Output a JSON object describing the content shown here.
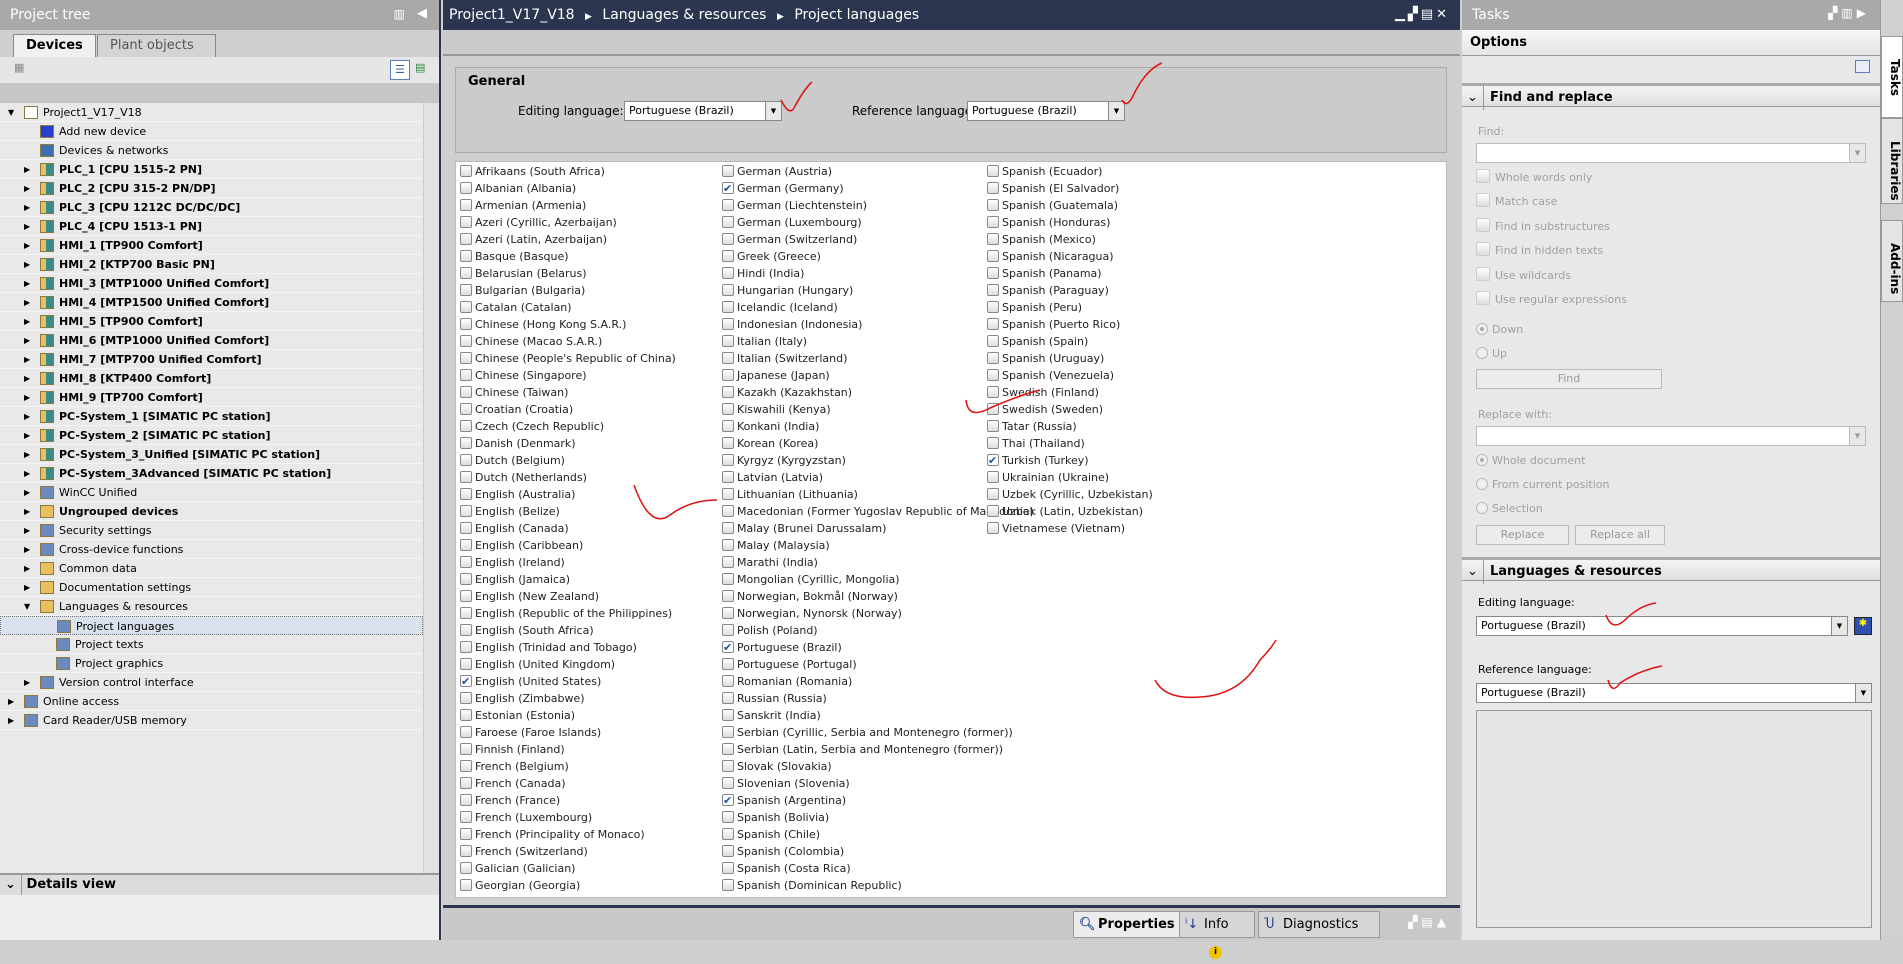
{
  "project_tree": {
    "title": "Project tree",
    "tabs": [
      "Devices",
      "Plant objects"
    ],
    "items": [
      {
        "label": "Project1_V17_V18",
        "level": 0,
        "expand": "open",
        "icon": "project-icon",
        "bold": false
      },
      {
        "label": "Add new device",
        "level": 1,
        "expand": "",
        "icon": "add-device-icon",
        "bold": false
      },
      {
        "label": "Devices & networks",
        "level": 1,
        "expand": "",
        "icon": "network-icon",
        "bold": false
      },
      {
        "label": "PLC_1 [CPU 1515-2 PN]",
        "level": 1,
        "expand": "closed",
        "icon": "plc-folder-icon",
        "bold": true
      },
      {
        "label": "PLC_2 [CPU 315-2 PN/DP]",
        "level": 1,
        "expand": "closed",
        "icon": "plc-folder-icon",
        "bold": true
      },
      {
        "label": "PLC_3 [CPU 1212C DC/DC/DC]",
        "level": 1,
        "expand": "closed",
        "icon": "plc-folder-icon",
        "bold": true
      },
      {
        "label": "PLC_4 [CPU 1513-1 PN]",
        "level": 1,
        "expand": "closed",
        "icon": "plc-folder-icon",
        "bold": true
      },
      {
        "label": "HMI_1 [TP900 Comfort]",
        "level": 1,
        "expand": "closed",
        "icon": "hmi-folder-icon",
        "bold": true
      },
      {
        "label": "HMI_2 [KTP700 Basic PN]",
        "level": 1,
        "expand": "closed",
        "icon": "hmi-folder-icon",
        "bold": true
      },
      {
        "label": "HMI_3 [MTP1000 Unified Comfort]",
        "level": 1,
        "expand": "closed",
        "icon": "hmi-folder-icon",
        "bold": true
      },
      {
        "label": "HMI_4 [MTP1500 Unified Comfort]",
        "level": 1,
        "expand": "closed",
        "icon": "hmi-folder-icon",
        "bold": true
      },
      {
        "label": "HMI_5 [TP900 Comfort]",
        "level": 1,
        "expand": "closed",
        "icon": "hmi-folder-icon",
        "bold": true
      },
      {
        "label": "HMI_6 [MTP1000 Unified Comfort]",
        "level": 1,
        "expand": "closed",
        "icon": "hmi-folder-icon",
        "bold": true
      },
      {
        "label": "HMI_7 [MTP700 Unified Comfort]",
        "level": 1,
        "expand": "closed",
        "icon": "hmi-folder-icon",
        "bold": true
      },
      {
        "label": "HMI_8 [KTP400 Comfort]",
        "level": 1,
        "expand": "closed",
        "icon": "hmi-folder-icon",
        "bold": true
      },
      {
        "label": "HMI_9 [TP700 Comfort]",
        "level": 1,
        "expand": "closed",
        "icon": "hmi-folder-icon",
        "bold": true
      },
      {
        "label": "PC-System_1 [SIMATIC PC station]",
        "level": 1,
        "expand": "closed",
        "icon": "pc-folder-icon",
        "bold": true
      },
      {
        "label": "PC-System_2 [SIMATIC PC station]",
        "level": 1,
        "expand": "closed",
        "icon": "pc-folder-icon",
        "bold": true
      },
      {
        "label": "PC-System_3_Unified [SIMATIC PC station]",
        "level": 1,
        "expand": "closed",
        "icon": "pc-folder-icon",
        "bold": true
      },
      {
        "label": "PC-System_3Advanced [SIMATIC PC station]",
        "level": 1,
        "expand": "closed",
        "icon": "pc-folder-icon",
        "bold": true
      },
      {
        "label": "WinCC Unified",
        "level": 1,
        "expand": "closed",
        "icon": "wincc-icon",
        "bold": false
      },
      {
        "label": "Ungrouped devices",
        "level": 1,
        "expand": "closed",
        "icon": "folder-icon",
        "bold": true
      },
      {
        "label": "Security settings",
        "level": 1,
        "expand": "closed",
        "icon": "security-icon",
        "bold": false
      },
      {
        "label": "Cross-device functions",
        "level": 1,
        "expand": "closed",
        "icon": "cross-device-icon",
        "bold": false
      },
      {
        "label": "Common data",
        "level": 1,
        "expand": "closed",
        "icon": "folder-icon",
        "bold": false
      },
      {
        "label": "Documentation settings",
        "level": 1,
        "expand": "closed",
        "icon": "folder-icon",
        "bold": false
      },
      {
        "label": "Languages & resources",
        "level": 1,
        "expand": "open",
        "icon": "folder-icon",
        "bold": false
      },
      {
        "label": "Project languages",
        "level": 2,
        "expand": "",
        "icon": "languages-icon",
        "bold": false,
        "selected": true
      },
      {
        "label": "Project texts",
        "level": 2,
        "expand": "",
        "icon": "texts-icon",
        "bold": false
      },
      {
        "label": "Project graphics",
        "level": 2,
        "expand": "",
        "icon": "graphics-icon",
        "bold": false
      },
      {
        "label": "Version control interface",
        "level": 1,
        "expand": "closed",
        "icon": "version-control-icon",
        "bold": false
      },
      {
        "label": "Online access",
        "level": 0,
        "expand": "closed",
        "icon": "online-access-icon",
        "bold": false
      },
      {
        "label": "Card Reader/USB memory",
        "level": 0,
        "expand": "closed",
        "icon": "card-reader-icon",
        "bold": false
      }
    ],
    "details_view": "Details view"
  },
  "editor": {
    "breadcrumb": [
      "Project1_V17_V18",
      "Languages & resources",
      "Project languages"
    ],
    "general": {
      "title": "General",
      "editing_label": "Editing language:",
      "editing_value": "Portuguese (Brazil)",
      "reference_label": "Reference language:",
      "reference_value": "Portuguese (Brazil)"
    },
    "columns": [
      [
        "Afrikaans (South Africa)",
        "Albanian (Albania)",
        "Armenian (Armenia)",
        "Azeri (Cyrillic, Azerbaijan)",
        "Azeri (Latin, Azerbaijan)",
        "Basque (Basque)",
        "Belarusian (Belarus)",
        "Bulgarian (Bulgaria)",
        "Catalan (Catalan)",
        "Chinese (Hong Kong S.A.R.)",
        "Chinese (Macao S.A.R.)",
        "Chinese (People's Republic of China)",
        "Chinese (Singapore)",
        "Chinese (Taiwan)",
        "Croatian (Croatia)",
        "Czech (Czech Republic)",
        "Danish (Denmark)",
        "Dutch (Belgium)",
        "Dutch (Netherlands)",
        "English (Australia)",
        "English (Belize)",
        "English (Canada)",
        "English (Caribbean)",
        "English (Ireland)",
        "English (Jamaica)",
        "English (New Zealand)",
        "English (Republic of the Philippines)",
        "English (South Africa)",
        "English (Trinidad and Tobago)",
        "English (United Kingdom)",
        "English (United States)",
        "English (Zimbabwe)",
        "Estonian (Estonia)",
        "Faroese (Faroe Islands)",
        "Finnish (Finland)",
        "French (Belgium)",
        "French (Canada)",
        "French (France)",
        "French (Luxembourg)",
        "French (Principality of Monaco)",
        "French (Switzerland)",
        "Galician (Galician)",
        "Georgian (Georgia)"
      ],
      [
        "German (Austria)",
        "German (Germany)",
        "German (Liechtenstein)",
        "German (Luxembourg)",
        "German (Switzerland)",
        "Greek (Greece)",
        "Hindi (India)",
        "Hungarian (Hungary)",
        "Icelandic (Iceland)",
        "Indonesian (Indonesia)",
        "Italian (Italy)",
        "Italian (Switzerland)",
        "Japanese (Japan)",
        "Kazakh (Kazakhstan)",
        "Kiswahili (Kenya)",
        "Konkani (India)",
        "Korean (Korea)",
        "Kyrgyz (Kyrgyzstan)",
        "Latvian (Latvia)",
        "Lithuanian (Lithuania)",
        "Macedonian (Former Yugoslav Republic of Macedonia)",
        "Malay (Brunei Darussalam)",
        "Malay (Malaysia)",
        "Marathi (India)",
        "Mongolian (Cyrillic, Mongolia)",
        "Norwegian, Bokmål (Norway)",
        "Norwegian, Nynorsk (Norway)",
        "Polish (Poland)",
        "Portuguese (Brazil)",
        "Portuguese (Portugal)",
        "Romanian (Romania)",
        "Russian (Russia)",
        "Sanskrit (India)",
        "Serbian (Cyrillic, Serbia and Montenegro (former))",
        "Serbian (Latin, Serbia and Montenegro (former))",
        "Slovak (Slovakia)",
        "Slovenian (Slovenia)",
        "Spanish (Argentina)",
        "Spanish (Bolivia)",
        "Spanish (Chile)",
        "Spanish (Colombia)",
        "Spanish (Costa Rica)",
        "Spanish (Dominican Republic)"
      ],
      [
        "Spanish (Ecuador)",
        "Spanish (El Salvador)",
        "Spanish (Guatemala)",
        "Spanish (Honduras)",
        "Spanish (Mexico)",
        "Spanish (Nicaragua)",
        "Spanish (Panama)",
        "Spanish (Paraguay)",
        "Spanish (Peru)",
        "Spanish (Puerto Rico)",
        "Spanish (Spain)",
        "Spanish (Uruguay)",
        "Spanish (Venezuela)",
        "Swedish (Finland)",
        "Swedish (Sweden)",
        "Tatar (Russia)",
        "Thai (Thailand)",
        "Turkish (Turkey)",
        "Ukrainian (Ukraine)",
        "Uzbek (Cyrillic, Uzbekistan)",
        "Uzbek (Latin, Uzbekistan)",
        "Vietnamese (Vietnam)"
      ]
    ],
    "checked": [
      "German (Germany)",
      "English (United States)",
      "Portuguese (Brazil)",
      "Spanish (Argentina)",
      "Turkish (Turkey)"
    ]
  },
  "bottom_tabs": {
    "properties": "Properties",
    "info": "Info",
    "diagnostics": "Diagnostics"
  },
  "tasks": {
    "title": "Tasks",
    "options": "Options",
    "find_replace": {
      "title": "Find and replace",
      "find_label": "Find:",
      "checks": [
        "Whole words only",
        "Match case",
        "Find in substructures",
        "Find in hidden texts",
        "Use wildcards",
        "Use regular expressions"
      ],
      "dir": [
        "Down",
        "Up"
      ],
      "find_btn": "Find",
      "replace_label": "Replace with:",
      "scope": [
        "Whole document",
        "From current position",
        "Selection"
      ],
      "replace_btn": "Replace",
      "replace_all_btn": "Replace all"
    },
    "lang_res": {
      "title": "Languages & resources",
      "editing_label": "Editing language:",
      "editing_value": "Portuguese (Brazil)",
      "reference_label": "Reference language:",
      "reference_value": "Portuguese (Brazil)"
    }
  },
  "side_tabs": [
    "Tasks",
    "Libraries",
    "Add-ins"
  ]
}
